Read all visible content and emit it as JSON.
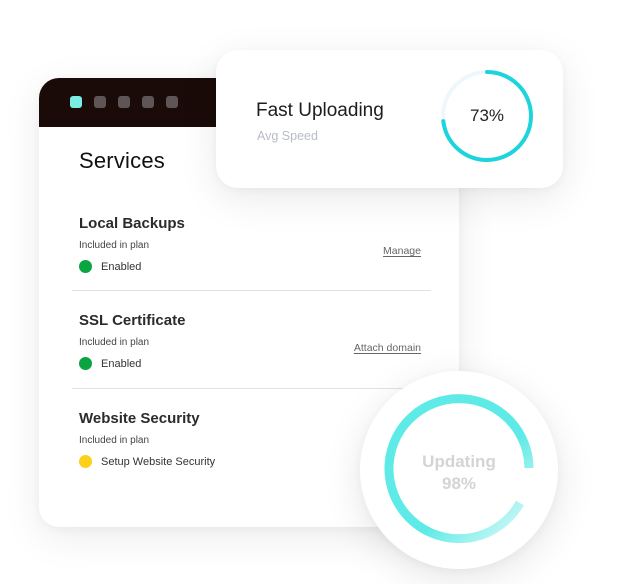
{
  "services_card": {
    "header_dots": [
      {
        "name": "dot-1",
        "active": true
      },
      {
        "name": "dot-2",
        "active": false
      },
      {
        "name": "dot-3",
        "active": false
      },
      {
        "name": "dot-4",
        "active": false
      },
      {
        "name": "dot-5",
        "active": false
      }
    ],
    "title": "Services",
    "items": [
      {
        "name": "Local Backups",
        "subtitle": "Included in plan",
        "status": "Enabled",
        "status_color": "#0aa441",
        "link": "Manage"
      },
      {
        "name": "SSL Certificate",
        "subtitle": "Included in plan",
        "status": "Enabled",
        "status_color": "#0aa441",
        "link": "Attach domain"
      },
      {
        "name": "Website Security",
        "subtitle": "Included in plan",
        "status": "Setup Website Security",
        "status_color": "#fdd01c",
        "link": ""
      }
    ]
  },
  "upload_card": {
    "title": "Fast Uploading",
    "subtitle": "Avg Speed",
    "percent_label": "73%",
    "progress": 0.73,
    "ring_color": "#1bd4dc",
    "track_color": "#eef8fc"
  },
  "update_widget": {
    "label": "Updating",
    "percent_label": "98%",
    "ring_color": "#5eeae6"
  },
  "colors": {
    "header_bg": "#1a0b08",
    "dot_active": "#7aeee5",
    "dot_inactive": "#5e5656"
  }
}
